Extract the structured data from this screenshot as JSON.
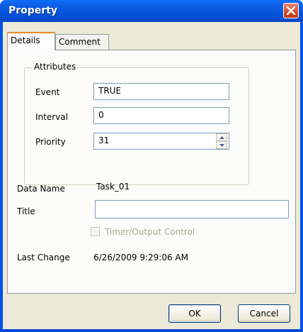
{
  "window": {
    "title": "Property",
    "close_icon": "close-icon"
  },
  "tabs": [
    {
      "label": "Details",
      "active": true
    },
    {
      "label": "Comment",
      "active": false
    }
  ],
  "attributes": {
    "group_label": "Attributes",
    "event": {
      "label": "Event",
      "value": "TRUE"
    },
    "interval": {
      "label": "Interval",
      "value": "0"
    },
    "priority": {
      "label": "Priority",
      "value": "31"
    }
  },
  "details": {
    "data_name_label": "Data Name",
    "data_name_value": "Task_01",
    "title_label": "Title",
    "title_value": "",
    "timer_output_label": "Timer/Output Control",
    "timer_output_checked": false,
    "last_change_label": "Last Change",
    "last_change_value": "6/26/2009 9:29:06 AM"
  },
  "buttons": {
    "ok": "OK",
    "cancel": "Cancel"
  }
}
